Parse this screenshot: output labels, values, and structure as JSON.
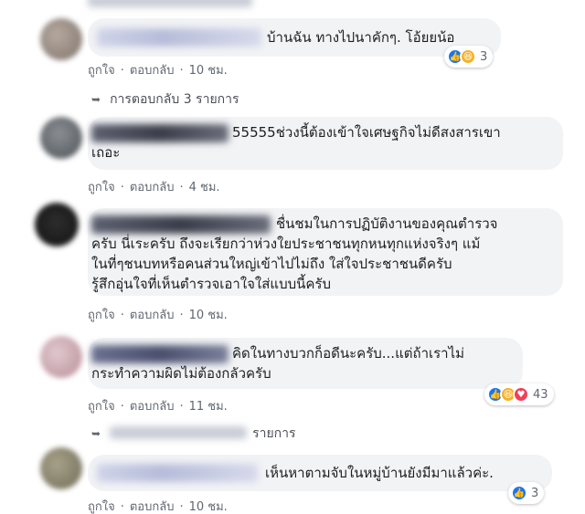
{
  "comments": [
    {
      "text_lines": [
        "บ้านฉัน ทางไปนาคักๆ. โอ้ยยน้อ"
      ],
      "actions": {
        "like": "ถูกใจ",
        "reply": "ตอบกลับ",
        "time": "10 ชม."
      },
      "reaction_count": "3",
      "reaction_icons": [
        "like-icon",
        "haha-icon"
      ]
    },
    {
      "text_lines": [
        "55555ช่วงนี้ต้องเข้าใจเศษฐกิจไม่ดีสงสารเขา",
        "เถอะ"
      ],
      "actions": {
        "like": "ถูกใจ",
        "reply": "ตอบกลับ",
        "time": "4 ชม."
      }
    },
    {
      "text_lines": [
        "ชื่นชมในการปฏิบัติงานของคุณตำรวจ",
        "ครับ นี่เระครับ ถึงจะเรียกว่าห่วงใยประชาชนทุกหนทุกแห่งจริงๆ แม้",
        "ในที่ๆชนบทหรือคนส่วนใหญ่เข้าไปไม่ถึง ใส่ใจประชาชนดีครับ",
        "รู้สึกอุ่นใจที่เห็นตำรวจเอาใจใส่แบบนี้ครับ"
      ],
      "actions": {
        "like": "ถูกใจ",
        "reply": "ตอบกลับ",
        "time": "10 ชม."
      }
    },
    {
      "text_lines": [
        "คิดในทางบวกก็อดีนะครับ...แต่ถ้าเราไม่",
        "กระทำความผิดไม่ต้องกลัวครับ"
      ],
      "actions": {
        "like": "ถูกใจ",
        "reply": "ตอบกลับ",
        "time": "11 ชม."
      },
      "reaction_count": "43",
      "reaction_icons": [
        "like-icon",
        "haha-icon",
        "love-icon"
      ]
    },
    {
      "text_lines": [
        "เห็นหาตามจับในหมู่บ้านยังมีมาแล้วค่ะ."
      ],
      "actions": {
        "like": "ถูกใจ",
        "reply": "ตอบกลับ",
        "time": "10 ชม."
      },
      "reaction_count": "3",
      "reaction_icons": [
        "like-icon"
      ]
    }
  ],
  "replies_links": [
    {
      "label": "การตอบกลับ 3 รายการ"
    },
    {
      "label": "รายการ"
    }
  ],
  "colors": {
    "like": "#1877f2",
    "haha": "#f7b125",
    "love": "#f33e58",
    "bubble": "#f2f3f5"
  }
}
